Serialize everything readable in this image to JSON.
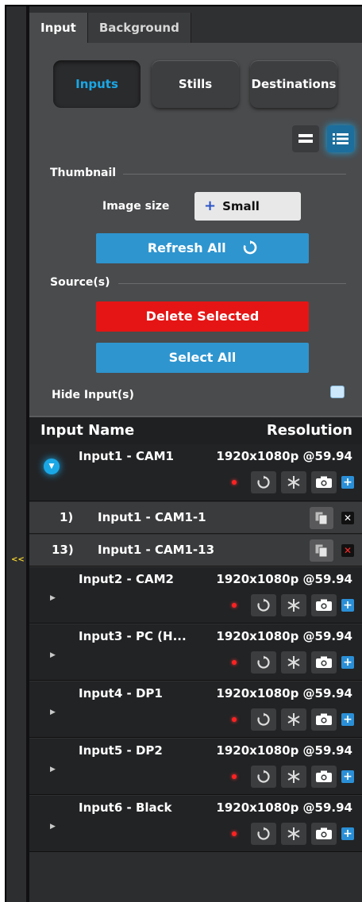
{
  "tabs": [
    {
      "label": "Input",
      "active": true
    },
    {
      "label": "Background",
      "active": false
    }
  ],
  "segments": [
    {
      "label": "Inputs",
      "active": true
    },
    {
      "label": "Stills",
      "active": false
    },
    {
      "label": "Destinations",
      "active": false
    }
  ],
  "view_icons": [
    "grid-view-icon",
    "list-view-icon"
  ],
  "thumbnail": {
    "section_label": "Thumbnail",
    "image_size_label": "Image size",
    "image_size_value": "Small",
    "image_size_prefix": "+",
    "refresh_label": "Refresh All"
  },
  "sources": {
    "section_label": "Source(s)",
    "delete_label": "Delete Selected",
    "select_all_label": "Select All",
    "hide_label": "Hide Input(s)"
  },
  "collapse_label": "<<",
  "list": {
    "header_name": "Input Name",
    "header_resolution": "Resolution",
    "rows": [
      {
        "name": "Input1 - CAM1",
        "resolution": "1920x1080p @59.94",
        "expanded": true
      },
      {
        "name": "Input2 - CAM2",
        "resolution": "1920x1080p @59.94",
        "expanded": false
      },
      {
        "name": "Input3 - PC (H...",
        "resolution": "1920x1080p @59.94",
        "expanded": false
      },
      {
        "name": "Input4 - DP1",
        "resolution": "1920x1080p @59.94",
        "expanded": false
      },
      {
        "name": "Input5 - DP2",
        "resolution": "1920x1080p @59.94",
        "expanded": false
      },
      {
        "name": "Input6 - Black",
        "resolution": "1920x1080p @59.94",
        "expanded": false
      }
    ],
    "subitems": [
      {
        "index": "1)",
        "name": "Input1 - CAM1-1"
      },
      {
        "index": "13)",
        "name": "Input1 - CAM1-13"
      }
    ]
  },
  "colors": {
    "accent_blue": "#1aa7e6",
    "button_blue": "#2e95cf",
    "button_red": "#e51515"
  }
}
